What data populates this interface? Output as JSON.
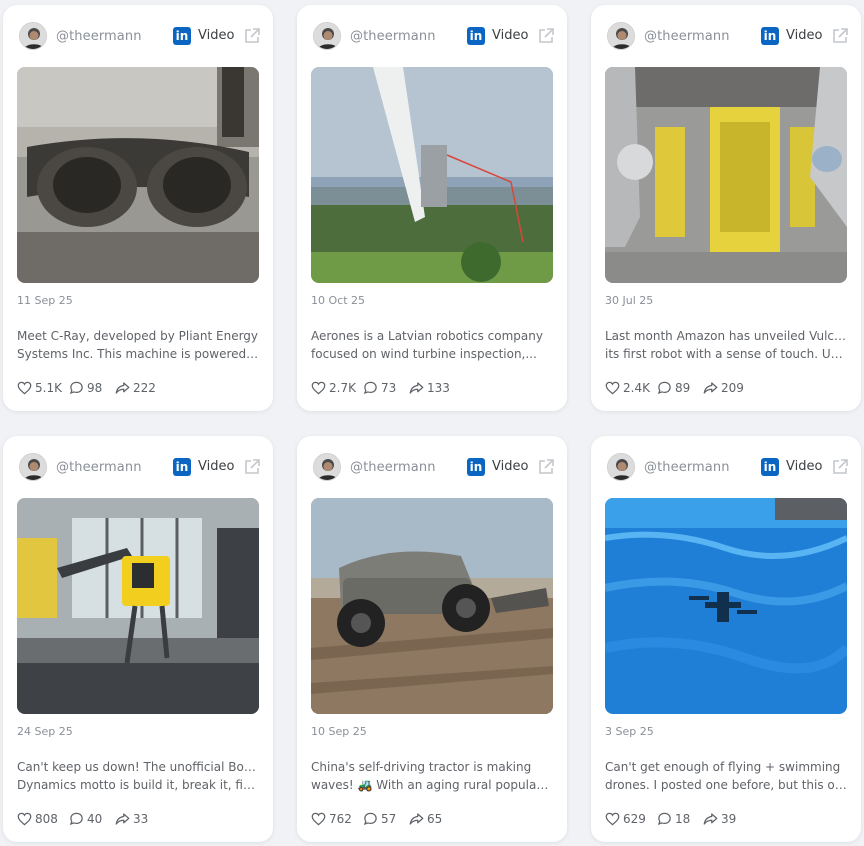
{
  "cards": [
    {
      "handle": "@theermann",
      "source": "Video",
      "date": "11 Sep 25",
      "line1": "Meet C-Ray, developed by Pliant Energy",
      "line2": "Systems Inc. This machine is powered b...",
      "likes": "5.1K",
      "comments": "98",
      "shares": "222",
      "image": "robot-ray-prototype"
    },
    {
      "handle": "@theermann",
      "source": "Video",
      "date": "10 Oct 25",
      "line1": "Aerones is a Latvian robotics company",
      "line2": "focused on wind turbine inspection,...",
      "likes": "2.7K",
      "comments": "73",
      "shares": "133",
      "image": "wind-turbine-robot"
    },
    {
      "handle": "@theermann",
      "source": "Video",
      "date": "30 Jul 25",
      "line1": "Last month Amazon has unveiled Vulcan,",
      "line2": "its first robot with a sense of touch. Unlik...",
      "likes": "2.4K",
      "comments": "89",
      "shares": "209",
      "image": "warehouse-robot-arms"
    },
    {
      "handle": "@theermann",
      "source": "Video",
      "date": "24 Sep 25",
      "line1": "Can't keep us down! The unofficial Boston",
      "line2": "Dynamics motto is build it, break it, fix it...",
      "likes": "808",
      "comments": "40",
      "shares": "33",
      "image": "spot-robot-dog"
    },
    {
      "handle": "@theermann",
      "source": "Video",
      "date": "10 Sep 25",
      "line1": "China's self-driving tractor is making",
      "line2": "waves! 🚜 With an aging rural populatio...",
      "likes": "762",
      "comments": "57",
      "shares": "65",
      "image": "autonomous-tractor"
    },
    {
      "handle": "@theermann",
      "source": "Video",
      "date": "3 Sep 25",
      "line1": "Can't get enough of flying + swimming",
      "line2": "drones. I posted one before, but this one...",
      "likes": "629",
      "comments": "18",
      "shares": "39",
      "image": "drone-over-pool"
    }
  ],
  "colors": {
    "linkedin": "#0a66c2",
    "muted": "#8a8f98",
    "text": "#5f6368",
    "background": "#f1f2f5"
  }
}
